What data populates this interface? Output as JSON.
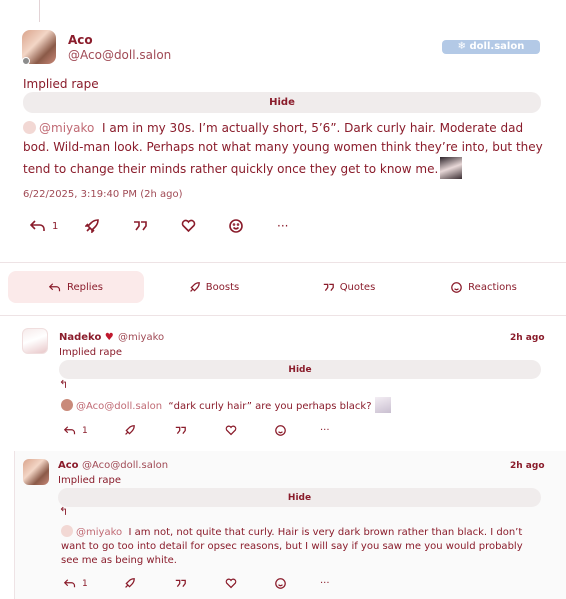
{
  "post": {
    "author_name": "Aco",
    "author_handle": "@Aco@doll.salon",
    "instance_badge": "❄ doll.salon (alpha)",
    "content_warning": "Implied rape",
    "hide_label": "Hide",
    "mention": "@miyako",
    "body": "I am in my 30s. I’m actually short, 5’6”. Dark curly hair. Moderate dad bod. Wild-man look. Perhaps not what many young women think they’re into, but they tend to change their minds rather quickly once they get to know me.",
    "timestamp": "6/22/2025, 3:19:40 PM (2h ago)",
    "reply_count": "1",
    "more_label": "···"
  },
  "tabs": [
    {
      "label": "Replies",
      "icon": "reply-icon"
    },
    {
      "label": "Boosts",
      "icon": "rocket-icon"
    },
    {
      "label": "Quotes",
      "icon": "quote-icon"
    },
    {
      "label": "Reactions",
      "icon": "smile-icon"
    }
  ],
  "replies": [
    {
      "author_name": "Nadeko",
      "heart": "♥",
      "author_handle": "@miyako",
      "time": "2h ago",
      "content_warning": "Implied rape",
      "hide_label": "Hide",
      "reply_arrow": "↰",
      "mention": "@Aco@doll.salon",
      "body": "“dark curly hair” are you perhaps black?",
      "reply_count": "1",
      "more_label": "···"
    },
    {
      "author_name": "Aco",
      "author_handle": "@Aco@doll.salon",
      "time": "2h ago",
      "content_warning": "Implied rape",
      "hide_label": "Hide",
      "reply_arrow": "↰",
      "mention": "@miyako",
      "body": "I am not, not quite that curly. Hair is very dark brown rather than black. I don’t want to go too into detail for opsec reasons, but I will say if you saw me you would probably see me as being white.",
      "reply_count": "1",
      "more_label": "···"
    }
  ],
  "colors": {
    "accent": "#8a1c2b",
    "secondary": "#a04a55",
    "badge": "#b3c9e6",
    "active_tab": "#fbeaea",
    "hide_button": "#f0ecec"
  }
}
